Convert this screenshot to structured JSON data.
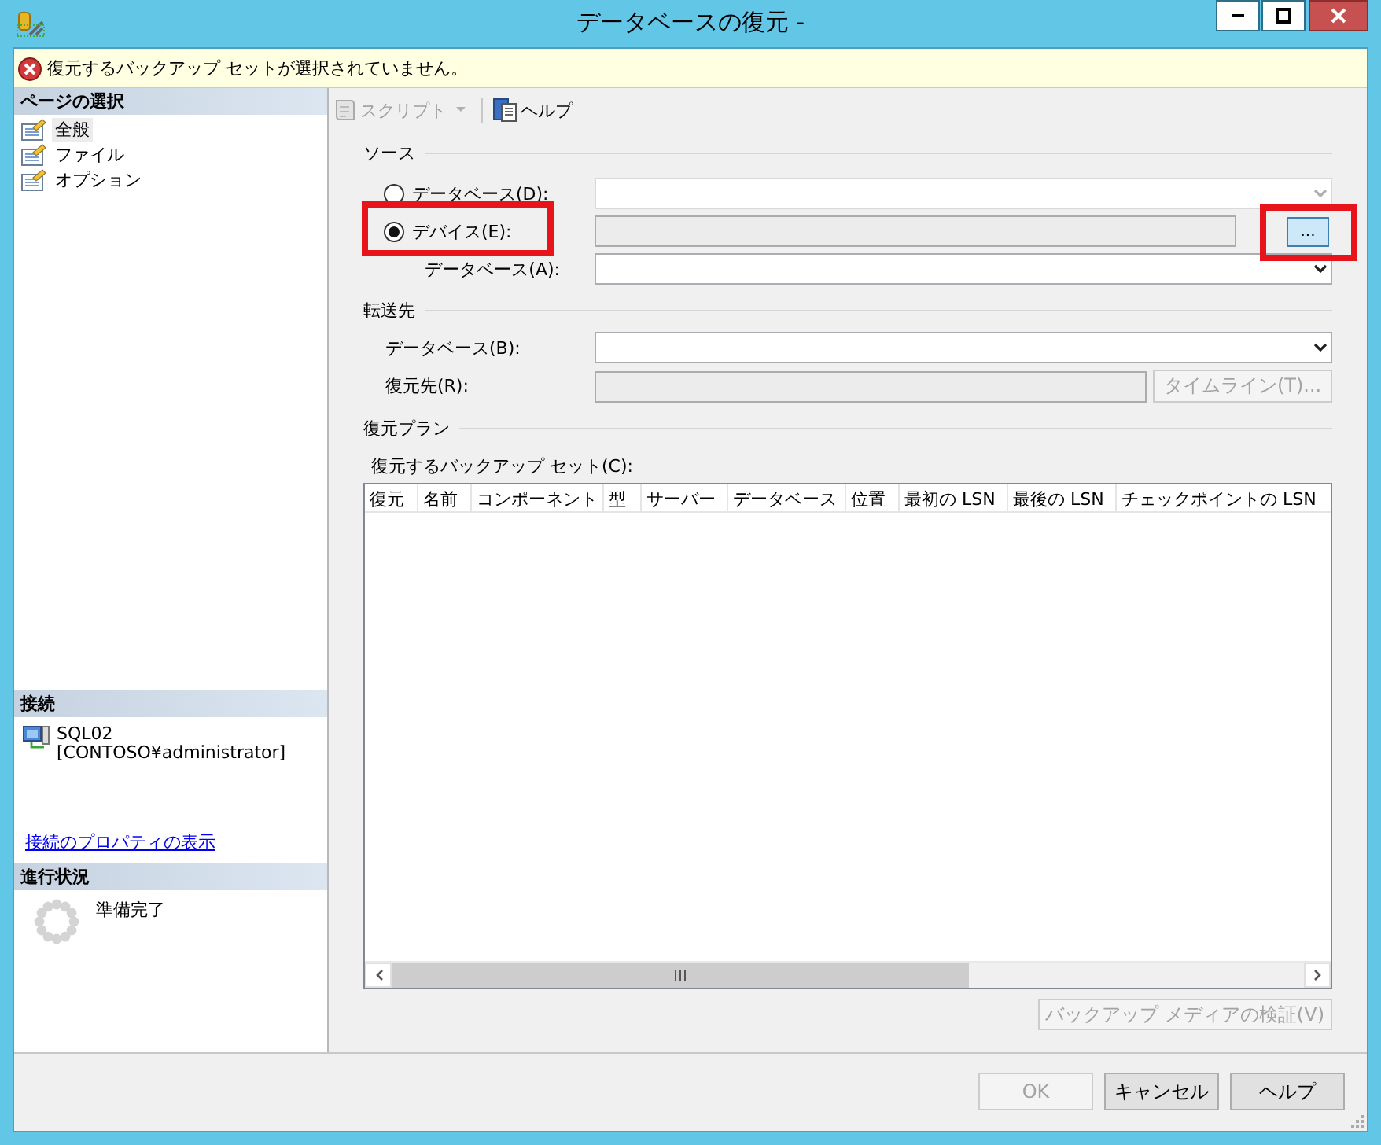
{
  "window": {
    "title": "データベースの復元 -"
  },
  "error_bar": {
    "message": "復元するバックアップ セットが選択されていません。"
  },
  "sidebar": {
    "page_header": "ページの選択",
    "pages": [
      {
        "label": "全般",
        "selected": true
      },
      {
        "label": "ファイル",
        "selected": false
      },
      {
        "label": "オプション",
        "selected": false
      }
    ],
    "connection": {
      "header": "接続",
      "server": "SQL02",
      "user": "[CONTOSO¥administrator]",
      "link": "接続のプロパティの表示"
    },
    "progress": {
      "header": "進行状況",
      "status": "準備完了"
    }
  },
  "toolbar": [
    {
      "kind": "script",
      "label": "スクリプト",
      "disabled": true
    },
    {
      "kind": "help",
      "label": "ヘルプ",
      "disabled": false
    }
  ],
  "source": {
    "title": "ソース",
    "options": [
      {
        "label": "データベース(D):",
        "selected": false,
        "highlighted": false,
        "field": {
          "kind": "combo",
          "disabled": true
        }
      },
      {
        "label": "デバイス(E):",
        "selected": true,
        "highlighted": true,
        "field": {
          "kind": "text",
          "disabled": true
        }
      }
    ],
    "browse_button": {
      "label": "...",
      "highlighted": true
    },
    "database": {
      "label": "データベース(A):",
      "field": {
        "kind": "combo",
        "disabled": false
      }
    }
  },
  "destination": {
    "title": "転送先",
    "rows": [
      {
        "label": "データベース(B):",
        "field": {
          "kind": "combo",
          "disabled": false
        }
      },
      {
        "label": "復元先(R):",
        "field": {
          "kind": "text",
          "disabled": true
        }
      }
    ],
    "timeline_button": {
      "label": "タイムライン(T)...",
      "disabled": true
    }
  },
  "restore_plan": {
    "title": "復元プラン",
    "table_label": "復元するバックアップ セット(C):",
    "columns": [
      "復元",
      "名前",
      "コンポーネント",
      "型",
      "サーバー",
      "データベース",
      "位置",
      "最初の LSN",
      "最後の LSN",
      "チェックポイントの LSN"
    ],
    "verify_button": {
      "label": "バックアップ メディアの検証(V)",
      "disabled": true
    }
  },
  "buttons": [
    {
      "label": "OK",
      "disabled": true
    },
    {
      "label": "キャンセル",
      "disabled": false
    },
    {
      "label": "ヘルプ",
      "disabled": false
    }
  ]
}
